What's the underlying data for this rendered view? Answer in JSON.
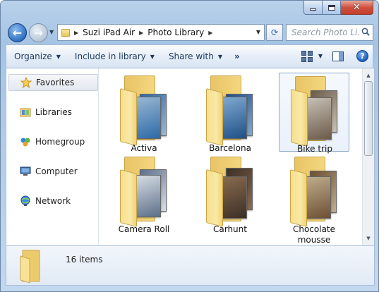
{
  "window": {
    "caption": {
      "close_glyph": "✕"
    }
  },
  "nav": {
    "back_icon": "←",
    "forward_icon": "→",
    "recent_icon": "▼"
  },
  "address": {
    "crumbs": [
      "Suzi iPad Air",
      "Photo Library"
    ],
    "separator": "▶",
    "dropdown": "▼"
  },
  "refresh_icon": "⟳",
  "search": {
    "placeholder": "Search Photo Li..."
  },
  "toolbar": {
    "organize": "Organize",
    "include": "Include in library",
    "share": "Share with",
    "more": "»",
    "dropdown_arrow": "▼",
    "help": "?"
  },
  "sidebar": {
    "items": [
      {
        "label": "Favorites",
        "icon": "star-icon",
        "selected": true
      },
      {
        "label": "Libraries",
        "icon": "libraries-icon"
      },
      {
        "label": "Homegroup",
        "icon": "homegroup-icon"
      },
      {
        "label": "Computer",
        "icon": "computer-icon"
      },
      {
        "label": "Network",
        "icon": "network-icon"
      }
    ]
  },
  "files": [
    {
      "name": "Activa",
      "photo_colors": [
        "#2c6aa8",
        "#9ab8d3"
      ],
      "selected": false
    },
    {
      "name": "Barcelona",
      "photo_colors": [
        "#1f4f86",
        "#7faad1"
      ],
      "selected": false
    },
    {
      "name": "Bike trip",
      "photo_colors": [
        "#6b5a48",
        "#c7c1b6"
      ],
      "selected": true
    },
    {
      "name": "Camera Roll",
      "photo_colors": [
        "#5b6f89",
        "#d9dee6"
      ],
      "selected": false
    },
    {
      "name": "Carhunt",
      "photo_colors": [
        "#3c2f26",
        "#8a6b4e"
      ],
      "selected": false
    },
    {
      "name": "Chocolate mousse",
      "photo_colors": [
        "#6d4f34",
        "#bfae8e"
      ],
      "selected": false
    }
  ],
  "scrollbar": {
    "up": "▲",
    "down": "▼"
  },
  "status": {
    "item_count": "16 items"
  }
}
